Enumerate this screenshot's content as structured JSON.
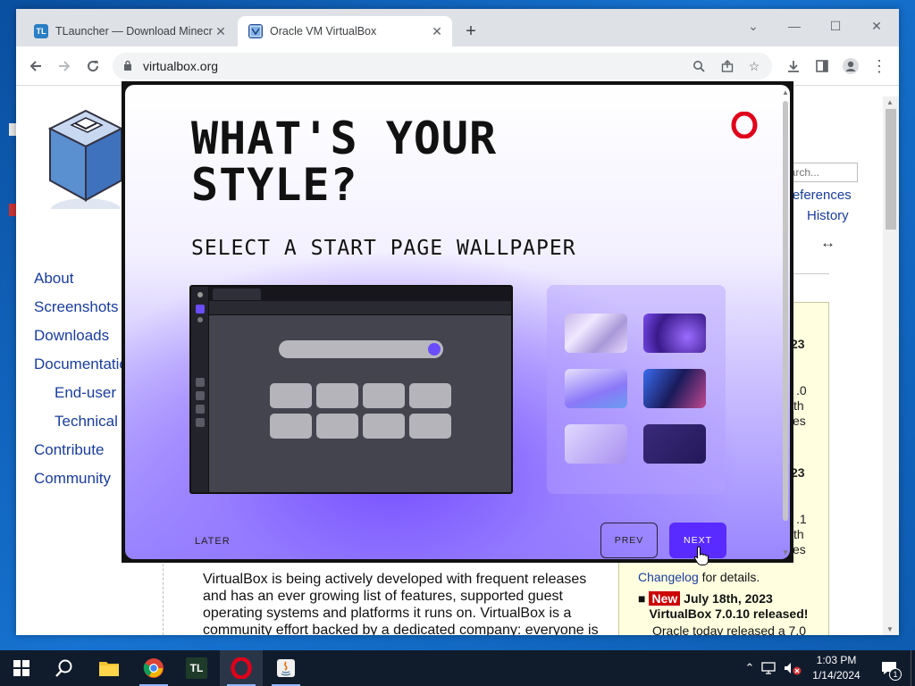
{
  "browser": {
    "tabs": [
      {
        "title": "TLauncher — Download Minecraft",
        "favicon": "TL"
      },
      {
        "title": "Oracle VM VirtualBox",
        "favicon": "VB"
      }
    ],
    "url": "virtualbox.org",
    "accent": "#1a73e8"
  },
  "virtualbox": {
    "nav": [
      "About",
      "Screenshots",
      "Downloads",
      "Documentation",
      "End-user",
      "Technical",
      "Contribute",
      "Community"
    ],
    "search_placeholder": "Search...",
    "right_links": [
      "References",
      "History"
    ],
    "news_fragments": [
      "23",
      ".0",
      "th",
      "es",
      "23",
      ".1",
      "th",
      "es"
    ],
    "changelog_link": "Changelog",
    "changelog_suffix": " for details.",
    "news_badge": "New",
    "news_headline": "July 18th, 2023 VirtualBox 7.0.10 released!",
    "news_tail": "Oracle today released a 7.0",
    "body_text": "VirtualBox is being actively developed with frequent releases and has an ever growing list of features, supported guest operating systems and platforms it runs on. VirtualBox is a community effort backed by a dedicated company: everyone is encouraged to contribute"
  },
  "opera_dialog": {
    "title": "WHAT'S YOUR STYLE?",
    "subtitle": "SELECT A START PAGE WALLPAPER",
    "later_label": "LATER",
    "prev_label": "PREV",
    "next_label": "NEXT",
    "accent": "#5a2bff",
    "brand_color": "#e0001b"
  },
  "taskbar": {
    "apps": [
      "windows-start",
      "search",
      "file-explorer",
      "chrome",
      "tlauncher",
      "opera",
      "java"
    ],
    "time": "1:03 PM",
    "date": "1/14/2024",
    "notification_count": "1"
  }
}
